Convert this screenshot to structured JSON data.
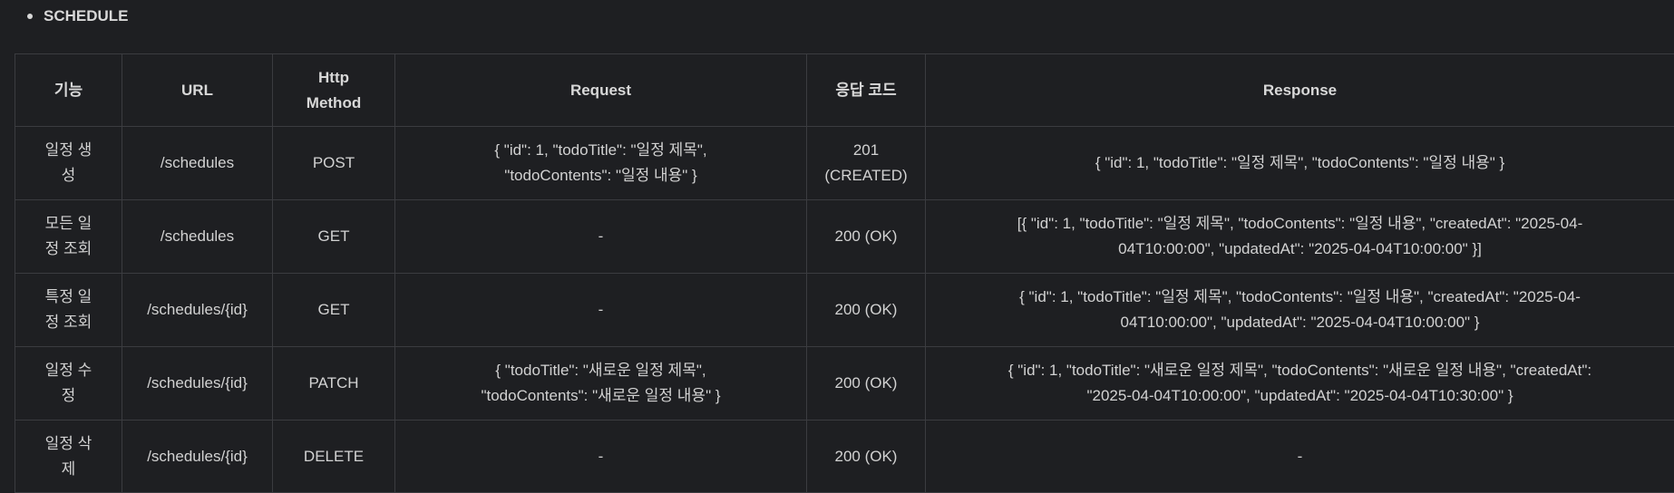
{
  "section": {
    "title": "SCHEDULE"
  },
  "table": {
    "headers": [
      "기능",
      "URL",
      "Http\nMethod",
      "Request",
      "응답 코드",
      "Response"
    ],
    "rows": [
      {
        "feature": "일정 생\n성",
        "url": "/schedules",
        "method": "POST",
        "request": "{ \"id\": 1, \"todoTitle\": \"일정 제목\",\n\"todoContents\": \"일정 내용\" }",
        "status": "201\n(CREATED)",
        "response": "{ \"id\": 1, \"todoTitle\": \"일정 제목\", \"todoContents\": \"일정 내용\" }"
      },
      {
        "feature": "모든 일\n정 조회",
        "url": "/schedules",
        "method": "GET",
        "request": "-",
        "status": "200 (OK)",
        "response": "[{ \"id\": 1, \"todoTitle\": \"일정 제목\", \"todoContents\": \"일정 내용\", \"createdAt\": \"2025-04-\n04T10:00:00\", \"updatedAt\": \"2025-04-04T10:00:00\" }]"
      },
      {
        "feature": "특정 일\n정 조회",
        "url": "/schedules/{id}",
        "method": "GET",
        "request": "-",
        "status": "200 (OK)",
        "response": "{ \"id\": 1, \"todoTitle\": \"일정 제목\", \"todoContents\": \"일정 내용\", \"createdAt\": \"2025-04-\n04T10:00:00\", \"updatedAt\": \"2025-04-04T10:00:00\" }"
      },
      {
        "feature": "일정 수\n정",
        "url": "/schedules/{id}",
        "method": "PATCH",
        "request": "{ \"todoTitle\": \"새로운 일정 제목\",\n\"todoContents\": \"새로운 일정 내용\" }",
        "status": "200 (OK)",
        "response": "{ \"id\": 1, \"todoTitle\": \"새로운 일정 제목\", \"todoContents\": \"새로운 일정 내용\", \"createdAt\":\n\"2025-04-04T10:00:00\", \"updatedAt\": \"2025-04-04T10:30:00\" }"
      },
      {
        "feature": "일정 삭\n제",
        "url": "/schedules/{id}",
        "method": "DELETE",
        "request": "-",
        "status": "200 (OK)",
        "response": "-"
      }
    ]
  }
}
